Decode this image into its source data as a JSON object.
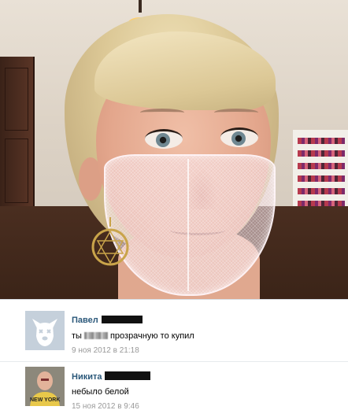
{
  "photo": {
    "icon": "selfie-photo"
  },
  "comments": [
    {
      "author": "Павел",
      "text_before": "ты",
      "text_after": "прозрачную то купил",
      "time": "9 ноя 2012 в 21:18",
      "avatar_icon": "default-dog-avatar-icon"
    },
    {
      "author": "Никита",
      "text": "небыло белой",
      "time": "15 ноя 2012 в 9:46",
      "avatar_icon": "user-photo-avatar",
      "avatar_shirt_text": "NEW YORK"
    }
  ],
  "colors": {
    "author_link": "#2b587a",
    "timestamp": "#999999",
    "default_avatar_bg": "#c5d0db"
  }
}
